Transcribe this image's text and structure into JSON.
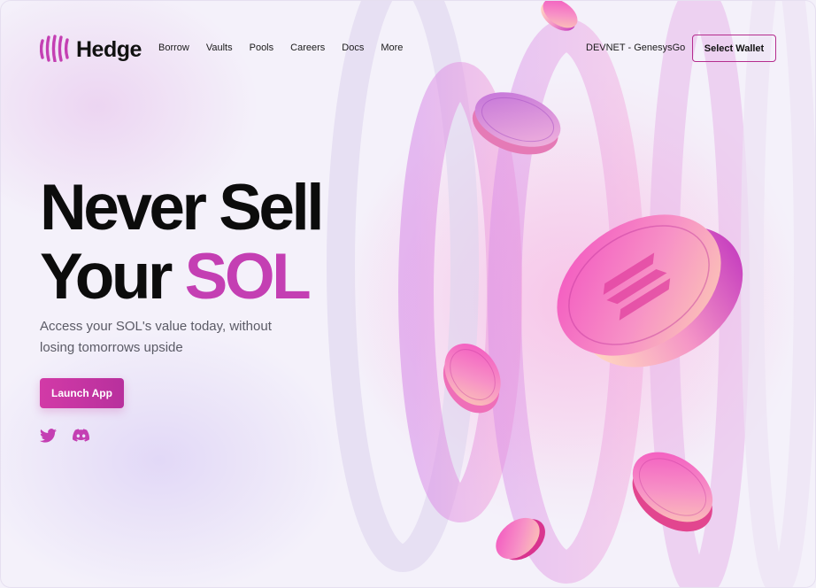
{
  "brand": {
    "name": "Hedge",
    "logo_icon": "hedge-bars-icon",
    "accent": "#c43fb3",
    "button": "#cc38a4"
  },
  "nav": {
    "items": [
      {
        "label": "Borrow"
      },
      {
        "label": "Vaults"
      },
      {
        "label": "Pools"
      },
      {
        "label": "Careers"
      },
      {
        "label": "Docs"
      },
      {
        "label": "More"
      }
    ]
  },
  "network_label": "DEVNET - GenesysGo",
  "wallet_button": "Select Wallet",
  "hero": {
    "title_line1": "Never Sell",
    "title_line2_prefix": "Your ",
    "title_line2_accent": "SOL",
    "subtitle": "Access your SOL's value today, without losing tomorrows upside",
    "cta": "Launch App"
  },
  "social": [
    {
      "icon": "twitter-icon"
    },
    {
      "icon": "discord-icon"
    }
  ]
}
